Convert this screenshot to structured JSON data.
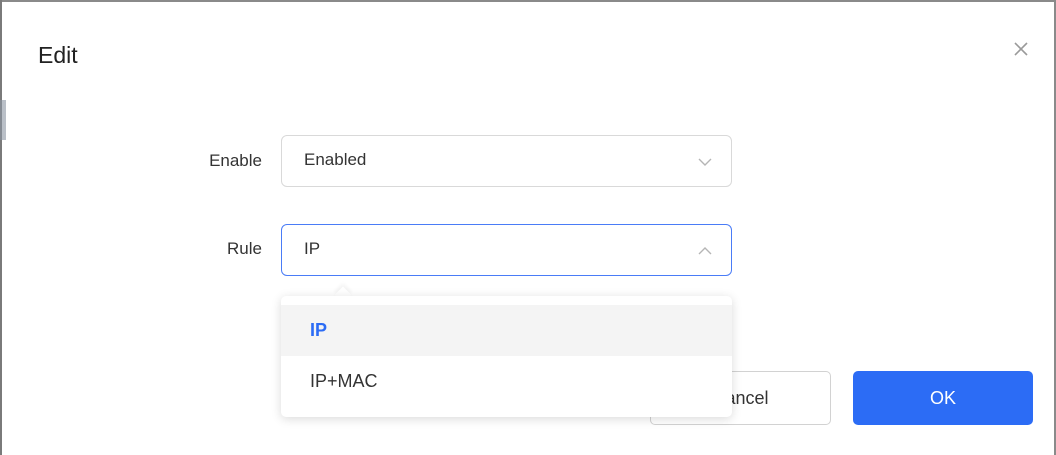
{
  "dialog": {
    "title": "Edit"
  },
  "form": {
    "enable": {
      "label": "Enable",
      "value": "Enabled"
    },
    "rule": {
      "label": "Rule",
      "value": "IP"
    }
  },
  "dropdown": {
    "options": [
      {
        "label": "IP",
        "selected": true
      },
      {
        "label": "IP+MAC",
        "selected": false
      }
    ]
  },
  "buttons": {
    "cancel": "Cancel",
    "ok": "OK"
  },
  "colors": {
    "primary": "#2c6cf5",
    "focus_border": "#4a7cf7",
    "selected_option_bg": "#f4f4f4"
  },
  "icons": {
    "close": "close-icon",
    "enable_chevron": "chevron-down-icon",
    "rule_chevron": "chevron-up-icon"
  }
}
